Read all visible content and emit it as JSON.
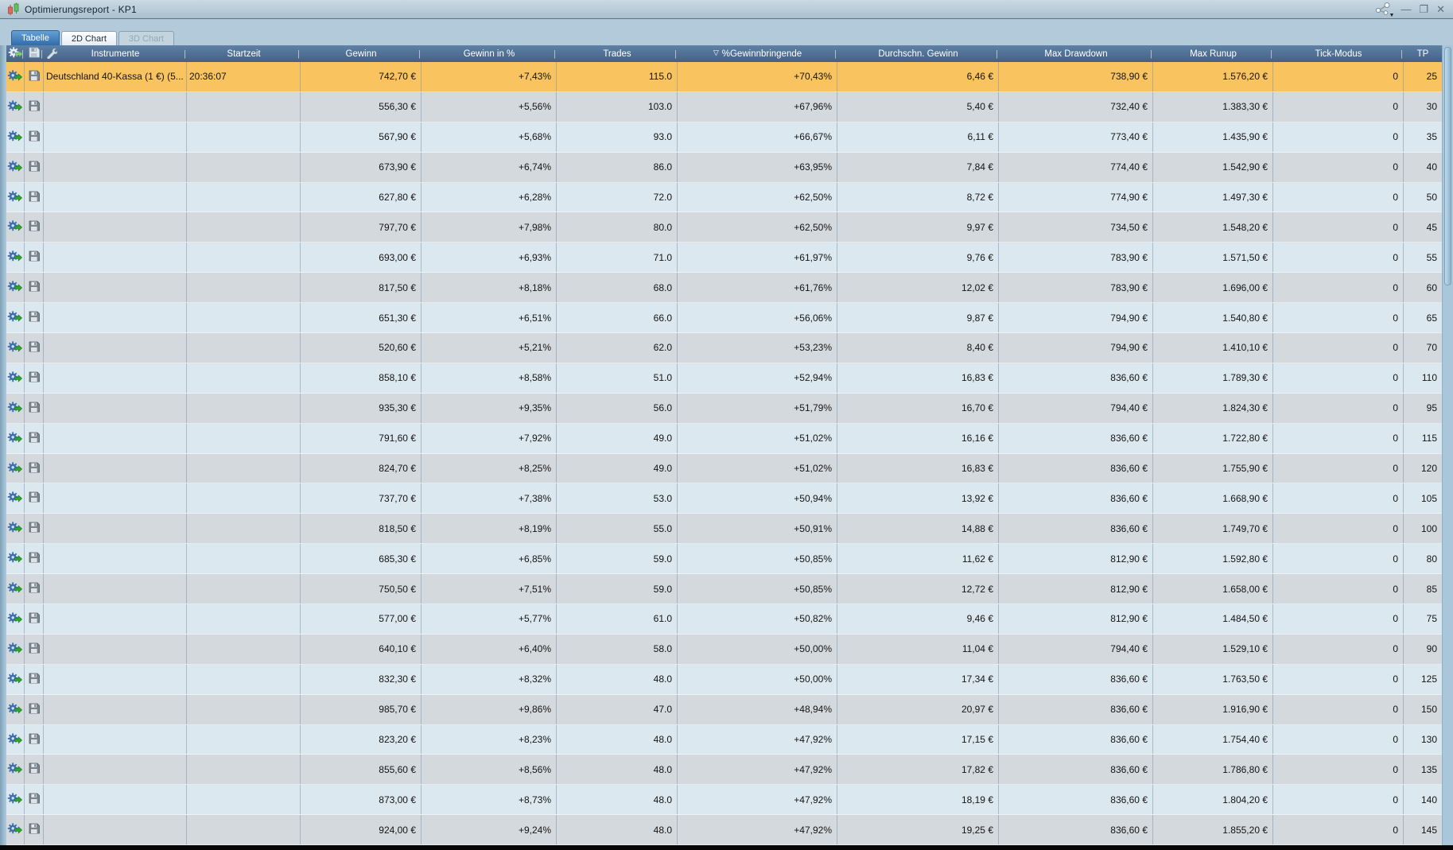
{
  "window": {
    "title": "Optimierungsreport - KP1",
    "controls": {
      "minimize_glyph": "—",
      "maximize_glyph": "❐",
      "close_glyph": "✕"
    }
  },
  "tabs": [
    {
      "label": "Tabelle",
      "state": "selected"
    },
    {
      "label": "2D Chart",
      "state": "normal"
    },
    {
      "label": "3D Chart",
      "state": "disabled"
    }
  ],
  "table": {
    "header_separator": "|",
    "sort_indicator": "▽",
    "icon_columns": [
      {
        "icon": "gear-run-icon"
      },
      {
        "icon": "save-icon"
      }
    ],
    "header_tool_icons": [
      "gear-run-icon",
      "save-icon",
      "wrench-icon"
    ],
    "columns": [
      {
        "key": "instrument",
        "label": "Instrumente",
        "align": "left",
        "sorted": false
      },
      {
        "key": "startzeit",
        "label": "Startzeit",
        "align": "left",
        "sorted": false
      },
      {
        "key": "gewinn",
        "label": "Gewinn",
        "align": "right",
        "sorted": false
      },
      {
        "key": "gewinn_in_pct",
        "label": "Gewinn in %",
        "align": "right",
        "sorted": false
      },
      {
        "key": "trades",
        "label": "Trades",
        "align": "right",
        "sorted": false
      },
      {
        "key": "gewinnbringende_pct",
        "label": "%Gewinnbringende",
        "align": "right",
        "sorted": true
      },
      {
        "key": "durchschn_gewinn",
        "label": "Durchschn. Gewinn",
        "align": "right",
        "sorted": false
      },
      {
        "key": "max_drawdown",
        "label": "Max Drawdown",
        "align": "right",
        "sorted": false
      },
      {
        "key": "max_runup",
        "label": "Max Runup",
        "align": "right",
        "sorted": false
      },
      {
        "key": "tick_modus",
        "label": "Tick-Modus",
        "align": "right",
        "sorted": false
      },
      {
        "key": "tp",
        "label": "TP",
        "align": "right",
        "sorted": false
      }
    ],
    "rows": [
      {
        "selected": true,
        "instrument": "Deutschland 40-Kassa (1 €) (5...",
        "startzeit": "20:36:07",
        "gewinn": "742,70 €",
        "gewinn_in_pct": "+7,43%",
        "trades": "115.0",
        "gewinnbringende_pct": "+70,43%",
        "durchschn_gewinn": "6,46 €",
        "max_drawdown": "738,90 €",
        "max_runup": "1.576,20 €",
        "tick_modus": "0",
        "tp": "25"
      },
      {
        "gewinn": "556,30 €",
        "gewinn_in_pct": "+5,56%",
        "trades": "103.0",
        "gewinnbringende_pct": "+67,96%",
        "durchschn_gewinn": "5,40 €",
        "max_drawdown": "732,40 €",
        "max_runup": "1.383,30 €",
        "tick_modus": "0",
        "tp": "30"
      },
      {
        "gewinn": "567,90 €",
        "gewinn_in_pct": "+5,68%",
        "trades": "93.0",
        "gewinnbringende_pct": "+66,67%",
        "durchschn_gewinn": "6,11 €",
        "max_drawdown": "773,40 €",
        "max_runup": "1.435,90 €",
        "tick_modus": "0",
        "tp": "35"
      },
      {
        "gewinn": "673,90 €",
        "gewinn_in_pct": "+6,74%",
        "trades": "86.0",
        "gewinnbringende_pct": "+63,95%",
        "durchschn_gewinn": "7,84 €",
        "max_drawdown": "774,40 €",
        "max_runup": "1.542,90 €",
        "tick_modus": "0",
        "tp": "40"
      },
      {
        "gewinn": "627,80 €",
        "gewinn_in_pct": "+6,28%",
        "trades": "72.0",
        "gewinnbringende_pct": "+62,50%",
        "durchschn_gewinn": "8,72 €",
        "max_drawdown": "774,90 €",
        "max_runup": "1.497,30 €",
        "tick_modus": "0",
        "tp": "50"
      },
      {
        "gewinn": "797,70 €",
        "gewinn_in_pct": "+7,98%",
        "trades": "80.0",
        "gewinnbringende_pct": "+62,50%",
        "durchschn_gewinn": "9,97 €",
        "max_drawdown": "734,50 €",
        "max_runup": "1.548,20 €",
        "tick_modus": "0",
        "tp": "45"
      },
      {
        "gewinn": "693,00 €",
        "gewinn_in_pct": "+6,93%",
        "trades": "71.0",
        "gewinnbringende_pct": "+61,97%",
        "durchschn_gewinn": "9,76 €",
        "max_drawdown": "783,90 €",
        "max_runup": "1.571,50 €",
        "tick_modus": "0",
        "tp": "55"
      },
      {
        "gewinn": "817,50 €",
        "gewinn_in_pct": "+8,18%",
        "trades": "68.0",
        "gewinnbringende_pct": "+61,76%",
        "durchschn_gewinn": "12,02 €",
        "max_drawdown": "783,90 €",
        "max_runup": "1.696,00 €",
        "tick_modus": "0",
        "tp": "60"
      },
      {
        "gewinn": "651,30 €",
        "gewinn_in_pct": "+6,51%",
        "trades": "66.0",
        "gewinnbringende_pct": "+56,06%",
        "durchschn_gewinn": "9,87 €",
        "max_drawdown": "794,90 €",
        "max_runup": "1.540,80 €",
        "tick_modus": "0",
        "tp": "65"
      },
      {
        "gewinn": "520,60 €",
        "gewinn_in_pct": "+5,21%",
        "trades": "62.0",
        "gewinnbringende_pct": "+53,23%",
        "durchschn_gewinn": "8,40 €",
        "max_drawdown": "794,90 €",
        "max_runup": "1.410,10 €",
        "tick_modus": "0",
        "tp": "70"
      },
      {
        "gewinn": "858,10 €",
        "gewinn_in_pct": "+8,58%",
        "trades": "51.0",
        "gewinnbringende_pct": "+52,94%",
        "durchschn_gewinn": "16,83 €",
        "max_drawdown": "836,60 €",
        "max_runup": "1.789,30 €",
        "tick_modus": "0",
        "tp": "110"
      },
      {
        "gewinn": "935,30 €",
        "gewinn_in_pct": "+9,35%",
        "trades": "56.0",
        "gewinnbringende_pct": "+51,79%",
        "durchschn_gewinn": "16,70 €",
        "max_drawdown": "794,40 €",
        "max_runup": "1.824,30 €",
        "tick_modus": "0",
        "tp": "95"
      },
      {
        "gewinn": "791,60 €",
        "gewinn_in_pct": "+7,92%",
        "trades": "49.0",
        "gewinnbringende_pct": "+51,02%",
        "durchschn_gewinn": "16,16 €",
        "max_drawdown": "836,60 €",
        "max_runup": "1.722,80 €",
        "tick_modus": "0",
        "tp": "115"
      },
      {
        "gewinn": "824,70 €",
        "gewinn_in_pct": "+8,25%",
        "trades": "49.0",
        "gewinnbringende_pct": "+51,02%",
        "durchschn_gewinn": "16,83 €",
        "max_drawdown": "836,60 €",
        "max_runup": "1.755,90 €",
        "tick_modus": "0",
        "tp": "120"
      },
      {
        "gewinn": "737,70 €",
        "gewinn_in_pct": "+7,38%",
        "trades": "53.0",
        "gewinnbringende_pct": "+50,94%",
        "durchschn_gewinn": "13,92 €",
        "max_drawdown": "836,60 €",
        "max_runup": "1.668,90 €",
        "tick_modus": "0",
        "tp": "105"
      },
      {
        "gewinn": "818,50 €",
        "gewinn_in_pct": "+8,19%",
        "trades": "55.0",
        "gewinnbringende_pct": "+50,91%",
        "durchschn_gewinn": "14,88 €",
        "max_drawdown": "836,60 €",
        "max_runup": "1.749,70 €",
        "tick_modus": "0",
        "tp": "100"
      },
      {
        "gewinn": "685,30 €",
        "gewinn_in_pct": "+6,85%",
        "trades": "59.0",
        "gewinnbringende_pct": "+50,85%",
        "durchschn_gewinn": "11,62 €",
        "max_drawdown": "812,90 €",
        "max_runup": "1.592,80 €",
        "tick_modus": "0",
        "tp": "80"
      },
      {
        "gewinn": "750,50 €",
        "gewinn_in_pct": "+7,51%",
        "trades": "59.0",
        "gewinnbringende_pct": "+50,85%",
        "durchschn_gewinn": "12,72 €",
        "max_drawdown": "812,90 €",
        "max_runup": "1.658,00 €",
        "tick_modus": "0",
        "tp": "85"
      },
      {
        "gewinn": "577,00 €",
        "gewinn_in_pct": "+5,77%",
        "trades": "61.0",
        "gewinnbringende_pct": "+50,82%",
        "durchschn_gewinn": "9,46 €",
        "max_drawdown": "812,90 €",
        "max_runup": "1.484,50 €",
        "tick_modus": "0",
        "tp": "75"
      },
      {
        "gewinn": "640,10 €",
        "gewinn_in_pct": "+6,40%",
        "trades": "58.0",
        "gewinnbringende_pct": "+50,00%",
        "durchschn_gewinn": "11,04 €",
        "max_drawdown": "794,40 €",
        "max_runup": "1.529,10 €",
        "tick_modus": "0",
        "tp": "90"
      },
      {
        "gewinn": "832,30 €",
        "gewinn_in_pct": "+8,32%",
        "trades": "48.0",
        "gewinnbringende_pct": "+50,00%",
        "durchschn_gewinn": "17,34 €",
        "max_drawdown": "836,60 €",
        "max_runup": "1.763,50 €",
        "tick_modus": "0",
        "tp": "125"
      },
      {
        "gewinn": "985,70 €",
        "gewinn_in_pct": "+9,86%",
        "trades": "47.0",
        "gewinnbringende_pct": "+48,94%",
        "durchschn_gewinn": "20,97 €",
        "max_drawdown": "836,60 €",
        "max_runup": "1.916,90 €",
        "tick_modus": "0",
        "tp": "150"
      },
      {
        "gewinn": "823,20 €",
        "gewinn_in_pct": "+8,23%",
        "trades": "48.0",
        "gewinnbringende_pct": "+47,92%",
        "durchschn_gewinn": "17,15 €",
        "max_drawdown": "836,60 €",
        "max_runup": "1.754,40 €",
        "tick_modus": "0",
        "tp": "130"
      },
      {
        "gewinn": "855,60 €",
        "gewinn_in_pct": "+8,56%",
        "trades": "48.0",
        "gewinnbringende_pct": "+47,92%",
        "durchschn_gewinn": "17,82 €",
        "max_drawdown": "836,60 €",
        "max_runup": "1.786,80 €",
        "tick_modus": "0",
        "tp": "135"
      },
      {
        "gewinn": "873,00 €",
        "gewinn_in_pct": "+8,73%",
        "trades": "48.0",
        "gewinnbringende_pct": "+47,92%",
        "durchschn_gewinn": "18,19 €",
        "max_drawdown": "836,60 €",
        "max_runup": "1.804,20 €",
        "tick_modus": "0",
        "tp": "140"
      },
      {
        "gewinn": "924,00 €",
        "gewinn_in_pct": "+9,24%",
        "trades": "48.0",
        "gewinnbringende_pct": "+47,92%",
        "durchschn_gewinn": "19,25 €",
        "max_drawdown": "836,60 €",
        "max_runup": "1.855,20 €",
        "tick_modus": "0",
        "tp": "145"
      }
    ]
  },
  "colors": {
    "selected_row": "#f9c360",
    "stripe_blue": "#dce8ef",
    "stripe_gray": "#d4d9dd",
    "header_bg": "#4d6f94",
    "tab_selected": "#3f7cb8",
    "titlebar_bg": "#b8cdda"
  }
}
